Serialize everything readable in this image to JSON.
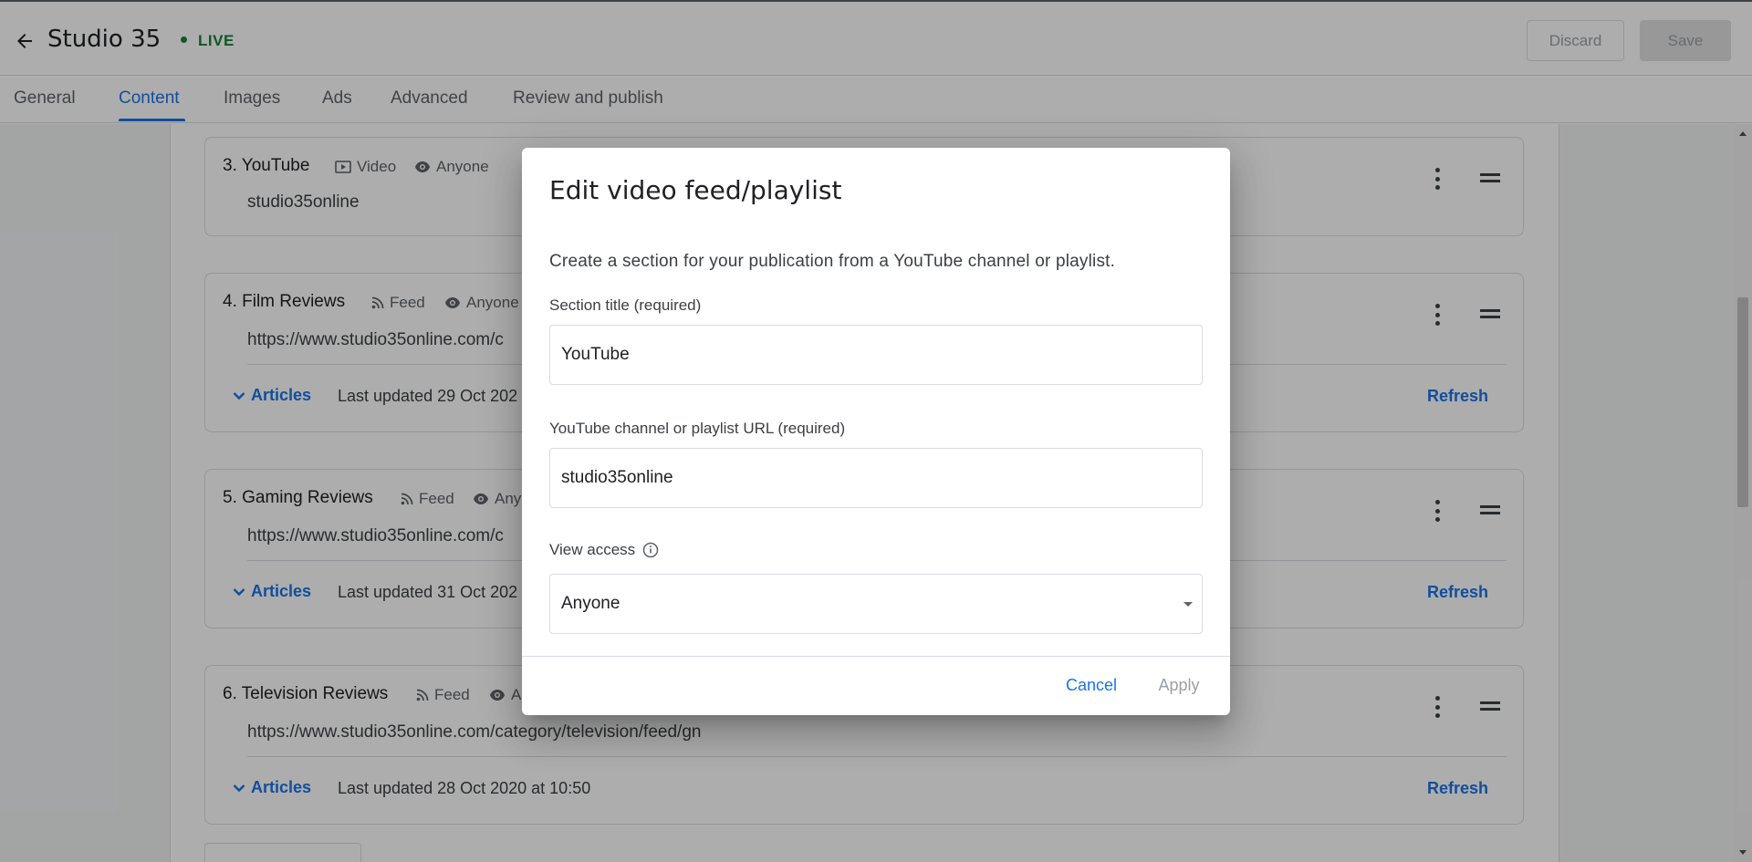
{
  "header": {
    "app_title": "Studio 35",
    "status": "LIVE",
    "discard_label": "Discard",
    "save_label": "Save"
  },
  "tabs": [
    {
      "label": "General"
    },
    {
      "label": "Content",
      "active": true
    },
    {
      "label": "Images"
    },
    {
      "label": "Ads"
    },
    {
      "label": "Advanced"
    },
    {
      "label": "Review and publish"
    }
  ],
  "sections": [
    {
      "title": "3. YouTube",
      "type": "Video",
      "access": "Anyone",
      "url": "studio35online"
    },
    {
      "title": "4. Film Reviews",
      "type": "Feed",
      "access": "Anyone",
      "url": "https://www.studio35online.com/c",
      "articles_label": "Articles",
      "updated": "Last updated 29 Oct 202",
      "refresh_label": "Refresh"
    },
    {
      "title": "5. Gaming Reviews",
      "type": "Feed",
      "access": "Any",
      "url": "https://www.studio35online.com/c",
      "articles_label": "Articles",
      "updated": "Last updated 31 Oct 202",
      "refresh_label": "Refresh"
    },
    {
      "title": "6. Television Reviews",
      "type": "Feed",
      "access": "A",
      "url": "https://www.studio35online.com/category/television/feed/gn",
      "articles_label": "Articles",
      "updated": "Last updated 28 Oct 2020 at 10:50",
      "refresh_label": "Refresh"
    }
  ],
  "dialog": {
    "title": "Edit video feed/playlist",
    "description": "Create a section for your publication from a YouTube channel or playlist.",
    "section_title_label": "Section title (required)",
    "section_title_value": "YouTube",
    "url_label": "YouTube channel or playlist URL (required)",
    "url_value": "studio35online",
    "view_access_label": "View access",
    "view_access_value": "Anyone",
    "cancel_label": "Cancel",
    "apply_label": "Apply"
  },
  "colors": {
    "accent": "#1a73e8",
    "live": "#188038",
    "scrim": "rgba(0,0,0,0.32)"
  },
  "icons": [
    "back-arrow-icon",
    "video-icon",
    "eye-icon",
    "rss-feed-icon",
    "chevron-down-icon",
    "more-vert-icon",
    "drag-handle-icon",
    "info-icon",
    "dropdown-caret-icon"
  ]
}
